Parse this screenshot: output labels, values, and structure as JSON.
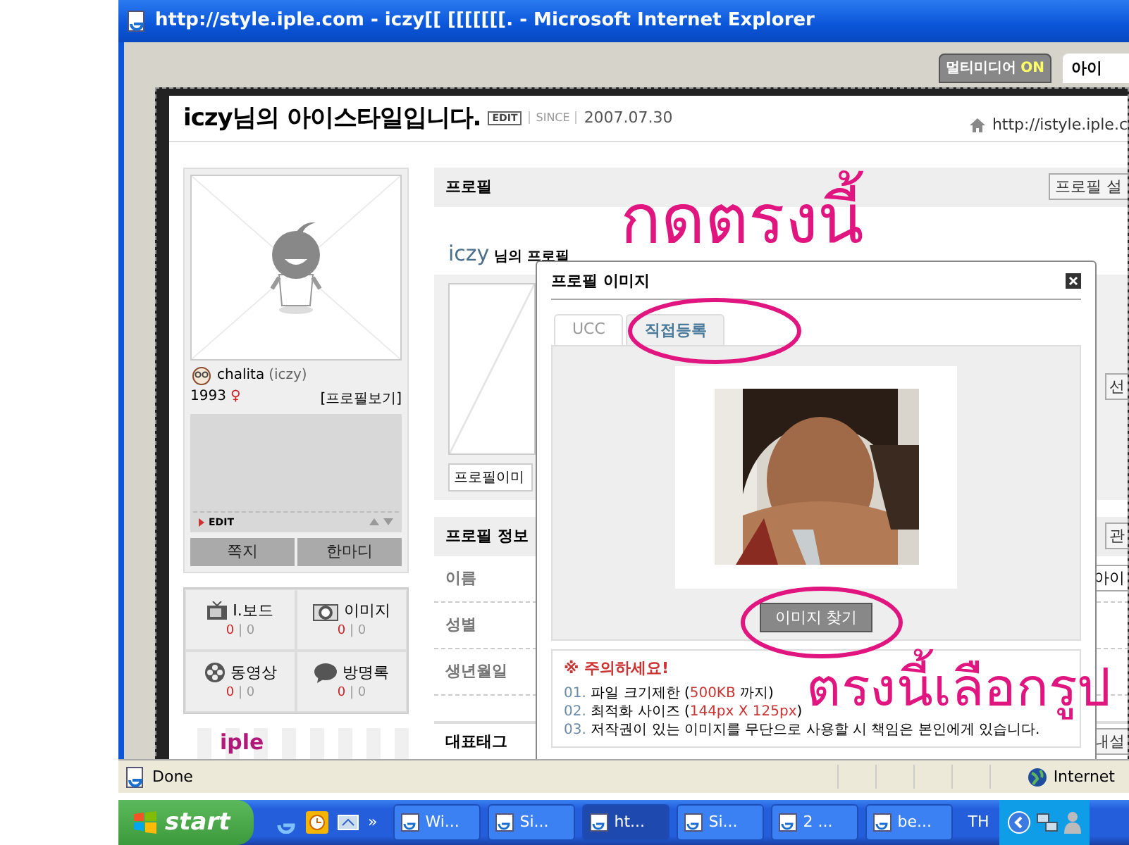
{
  "window": {
    "title": "http://style.iple.com - iczy[[ [[[[[[[. - Microsoft Internet Explorer"
  },
  "top_tabs": {
    "multimedia": {
      "label": "멀티미디어",
      "state": "ON"
    },
    "next_tab": "아이"
  },
  "header": {
    "title": "iczy님의 아이스타일입니다.",
    "edit_badge": "EDIT",
    "since_label": "SINCE",
    "date": "2007.07.30",
    "url": "http://istyle.iple.c"
  },
  "sidebar": {
    "user_name": "chalita",
    "user_id": "(iczy)",
    "birth_year": "1993",
    "gender": "♀",
    "profile_link": "[프로필보기]",
    "edit_label": "EDIT",
    "buttons": [
      "쪽지",
      "한마디"
    ],
    "stats": [
      {
        "label": "I.보드",
        "new": "0",
        "separator": "|",
        "total": "0"
      },
      {
        "label": "이미지",
        "new": "0",
        "separator": "|",
        "total": "0"
      },
      {
        "label": "동영상",
        "new": "0",
        "separator": "|",
        "total": "0"
      },
      {
        "label": "방명록",
        "new": "0",
        "separator": "|",
        "total": "0"
      }
    ],
    "logo": "iple"
  },
  "main": {
    "section_title": "프로필",
    "settings_button": "프로필 설",
    "owner_name": "iczy",
    "owner_suffix": "님의 프로필",
    "image_field": "프로필이미",
    "side_button": "선",
    "info_title": "프로필 정보",
    "info_button": "관",
    "info_rows": [
      {
        "label": "이름",
        "value": "아이"
      },
      {
        "label": "성별"
      },
      {
        "label": "생년월일"
      }
    ],
    "tag_title": "대표태그",
    "tag_button": "내설"
  },
  "popup": {
    "title": "프로필 이미지",
    "tabs": [
      {
        "label": "UCC",
        "selected": false
      },
      {
        "label": "직접등록",
        "selected": true
      }
    ],
    "browse_button": "이미지 찾기",
    "notice_title": "※ 주의하세요!",
    "notice_items": [
      {
        "num": "01.",
        "text": "파일 크기제한 (",
        "highlight": "500KB",
        "suffix": " 까지)"
      },
      {
        "num": "02.",
        "text": "최적화 사이즈 (",
        "highlight": "144px X 125px",
        "suffix": ")"
      },
      {
        "num": "03.",
        "text": "저작권이 있는 이미지를 무단으로 사용할 시 책임은 본인에게 있습니다."
      }
    ]
  },
  "annotations": [
    {
      "text": "กดตรงนี้"
    },
    {
      "text": "ตรงนี้เลือกรูป"
    }
  ],
  "status_bar": {
    "text": "Done",
    "zone": "Internet"
  },
  "taskbar": {
    "start": "start",
    "more": "»",
    "tasks": [
      {
        "label": "Wi...",
        "selected": false
      },
      {
        "label": "Si...",
        "selected": false
      },
      {
        "label": "ht...",
        "selected": true
      },
      {
        "label": "Si...",
        "selected": false
      },
      {
        "label": "2 ...",
        "selected": false
      },
      {
        "label": "be...",
        "selected": false
      }
    ],
    "language": "TH"
  }
}
